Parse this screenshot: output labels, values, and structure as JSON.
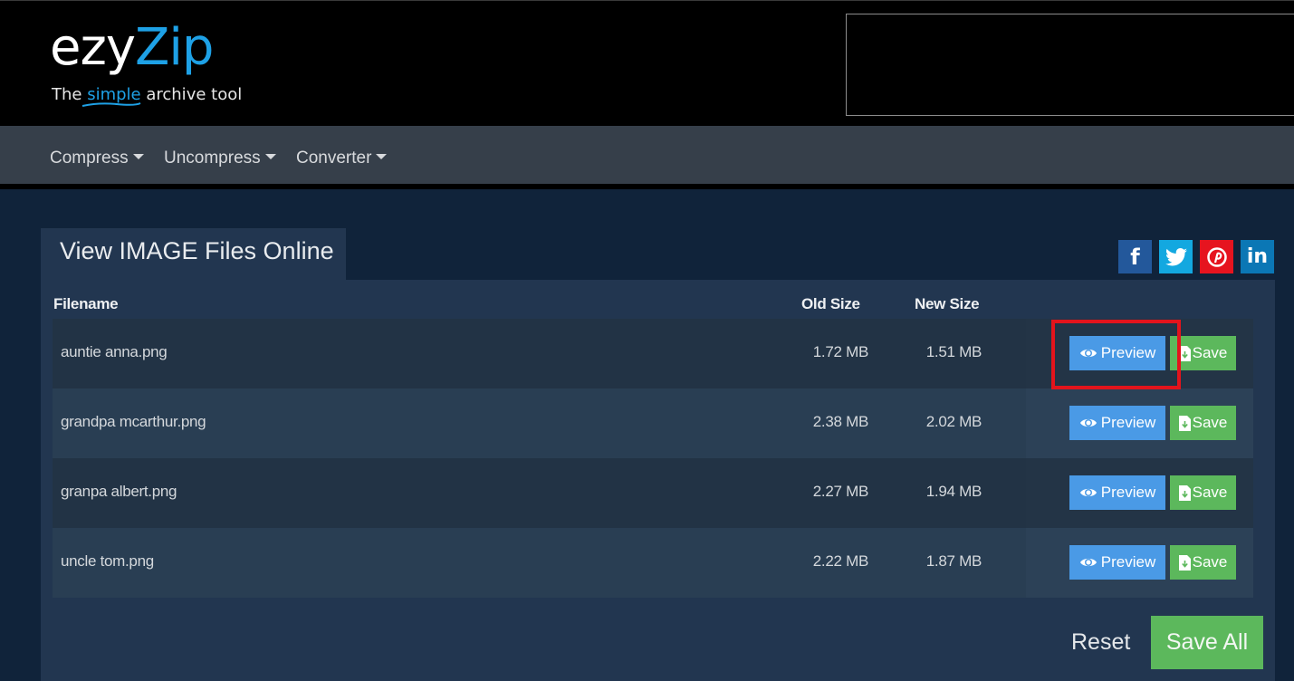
{
  "header": {
    "logo_part1": "ezy",
    "logo_part2": "Zip",
    "tagline_pre": "The ",
    "tagline_highlight": "simple",
    "tagline_post": " archive tool"
  },
  "nav": {
    "items": [
      {
        "label": "Compress"
      },
      {
        "label": "Uncompress"
      },
      {
        "label": "Converter"
      }
    ]
  },
  "panel": {
    "title": "View IMAGE Files Online"
  },
  "social": {
    "facebook": "f",
    "linkedin": "in"
  },
  "table": {
    "headers": {
      "filename": "Filename",
      "old_size": "Old Size",
      "new_size": "New Size"
    },
    "rows": [
      {
        "filename": "auntie anna.png",
        "old_size": "1.72 MB",
        "new_size": "1.51 MB",
        "preview": "Preview",
        "save": "Save"
      },
      {
        "filename": "grandpa mcarthur.png",
        "old_size": "2.38 MB",
        "new_size": "2.02 MB",
        "preview": "Preview",
        "save": "Save"
      },
      {
        "filename": "granpa albert.png",
        "old_size": "2.27 MB",
        "new_size": "1.94 MB",
        "preview": "Preview",
        "save": "Save"
      },
      {
        "filename": "uncle tom.png",
        "old_size": "2.22 MB",
        "new_size": "1.87 MB",
        "preview": "Preview",
        "save": "Save"
      }
    ]
  },
  "actions": {
    "reset": "Reset",
    "save_all": "Save All"
  },
  "colors": {
    "brand_blue": "#1ea1e6",
    "preview_button": "#4a9ae6",
    "save_button": "#5cb85c",
    "highlight_box": "#e3141c"
  }
}
